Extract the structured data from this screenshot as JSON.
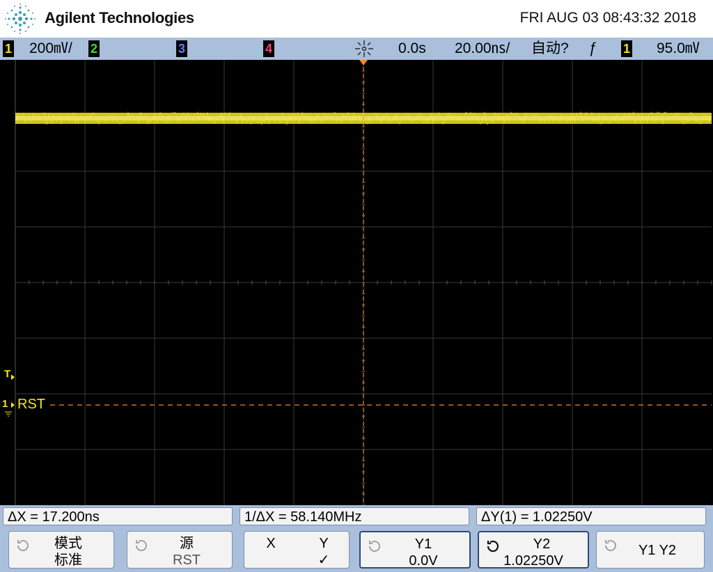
{
  "header": {
    "brand": "Agilent Technologies",
    "datetime": "FRI AUG 03 08:43:32 2018"
  },
  "status": {
    "ch1_num": "1",
    "ch1_scale": "200㎷/",
    "ch2_num": "2",
    "ch3_num": "3",
    "ch4_num": "4",
    "time_offset": "0.0s",
    "time_scale": "20.00㎱/",
    "trigger_mode": "自动?",
    "trigger_slope": "ƒ",
    "trigger_source": "1",
    "trigger_level": "95.0㎷"
  },
  "screen": {
    "trigger_marker": "T",
    "ch1_marker": "1",
    "ch1_label": "RST",
    "grid": {
      "cols": 10,
      "rows": 8
    },
    "trace": {
      "level_div": 1.05,
      "color": "#f2e61c"
    },
    "cursor_color": "#f28a2e"
  },
  "measurements": {
    "delta_x": "ΔX = 17.200ns",
    "inv_delta_x": "1/ΔX = 58.140MHz",
    "delta_y": "ΔY(1) = 1.02250V"
  },
  "softkeys": {
    "mode_line1": "模式",
    "mode_line2": "标准",
    "source_line1": "源",
    "source_line2": "RST",
    "x_label": "X",
    "y_label": "Y",
    "y_check": "✓",
    "y1_line1": "Y1",
    "y1_line2": "0.0V",
    "y2_line1": "Y2",
    "y2_line2": "1.02250V",
    "y1y2_label": "Y1 Y2"
  }
}
